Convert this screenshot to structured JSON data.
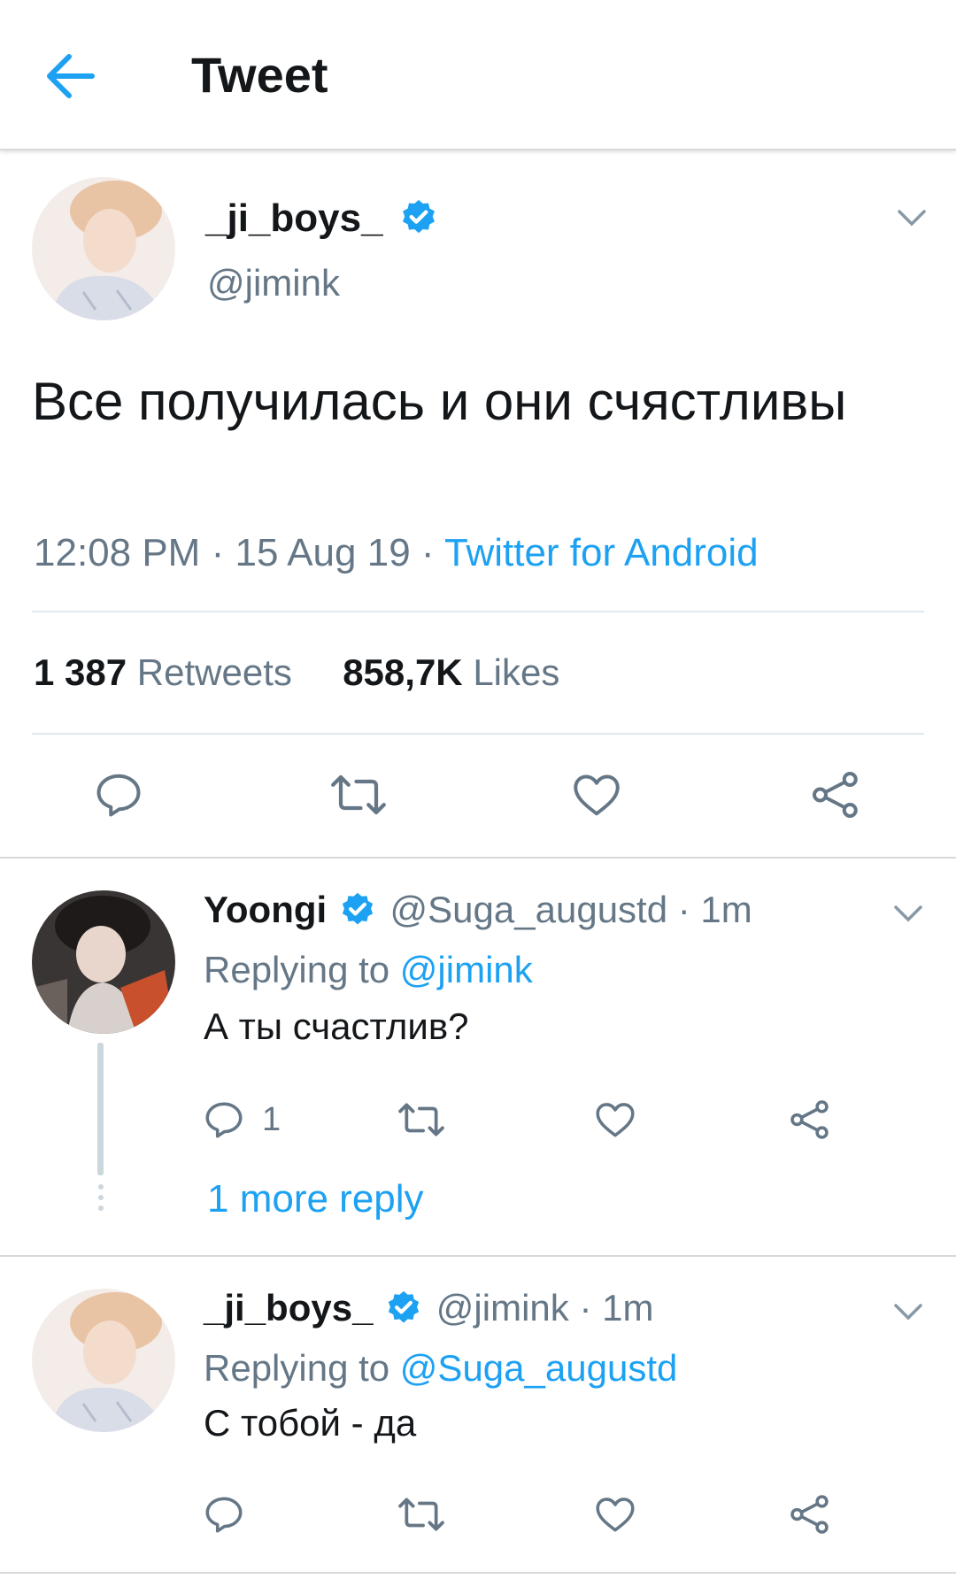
{
  "header": {
    "title": "Tweet",
    "back_icon": "arrow-left-icon",
    "accent": "#1da1f2"
  },
  "tweet": {
    "display_name": "_ji_boys_",
    "handle": "@jimink",
    "text": "Все получилась и они счястливы",
    "time": "12:08 PM",
    "date": "15 Aug 19",
    "source": "Twitter for Android",
    "retweets_count": "1 387",
    "retweets_label": "Retweets",
    "likes_count": "858,7K",
    "likes_label": "Likes"
  },
  "replies": [
    {
      "display_name": "Yoongi",
      "handle": "@Suga_augustd",
      "age": "1m",
      "replying_label": "Replying to",
      "replying_to": "@jimink",
      "text": "А ты счастлив?",
      "reply_count": "1",
      "more_replies": "1 more reply"
    },
    {
      "display_name": "_ji_boys_",
      "handle": "@jimink",
      "age": "1m",
      "replying_label": "Replying to",
      "replying_to": "@Suga_augustd",
      "text": "С тобой - да"
    }
  ],
  "colors": {
    "text": "#14171a",
    "secondary": "#657786",
    "link": "#1da1f2",
    "divider": "#e1e8ed"
  }
}
